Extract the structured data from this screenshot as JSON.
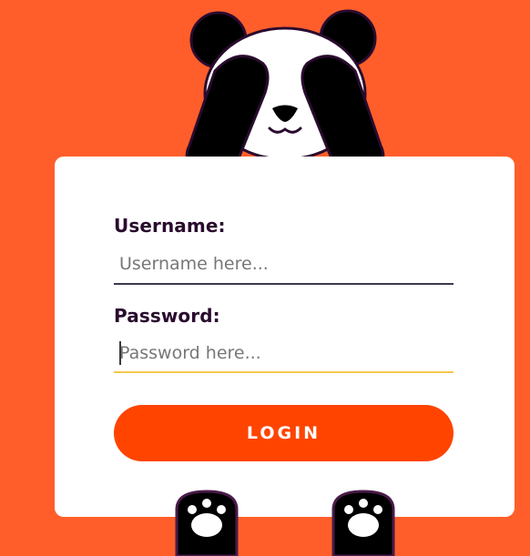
{
  "form": {
    "username_label": "Username:",
    "username_placeholder": "Username here...",
    "password_label": "Password:",
    "password_placeholder": "Password here...",
    "login_label": "LOGIN"
  },
  "colors": {
    "background": "#ff5e2b",
    "card": "#ffffff",
    "button": "#ff4400",
    "label": "#2a0b2e",
    "username_underline": "#3a3a4a",
    "password_underline_focused": "#f5c84c"
  },
  "icons": {
    "mascot": "panda-covering-eyes",
    "paws": "paw-icon"
  }
}
